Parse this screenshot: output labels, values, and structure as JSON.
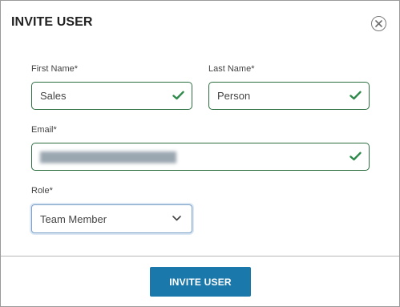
{
  "dialog": {
    "title": "INVITE USER",
    "close_icon": "close-circle-icon"
  },
  "form": {
    "first_name": {
      "label": "First Name*",
      "value": "Sales",
      "status_icon": "checkmark-icon"
    },
    "last_name": {
      "label": "Last Name*",
      "value": "Person",
      "status_icon": "checkmark-icon"
    },
    "email": {
      "label": "Email*",
      "value": "(redacted)",
      "status_icon": "checkmark-icon"
    },
    "role": {
      "label": "Role*",
      "selected": "Team Member",
      "dropdown_icon": "chevron-down-icon"
    }
  },
  "footer": {
    "submit_label": "INVITE USER"
  },
  "colors": {
    "valid_border": "#2c6e3f",
    "check_green": "#2e8a4a",
    "primary_button": "#1a78ab"
  }
}
